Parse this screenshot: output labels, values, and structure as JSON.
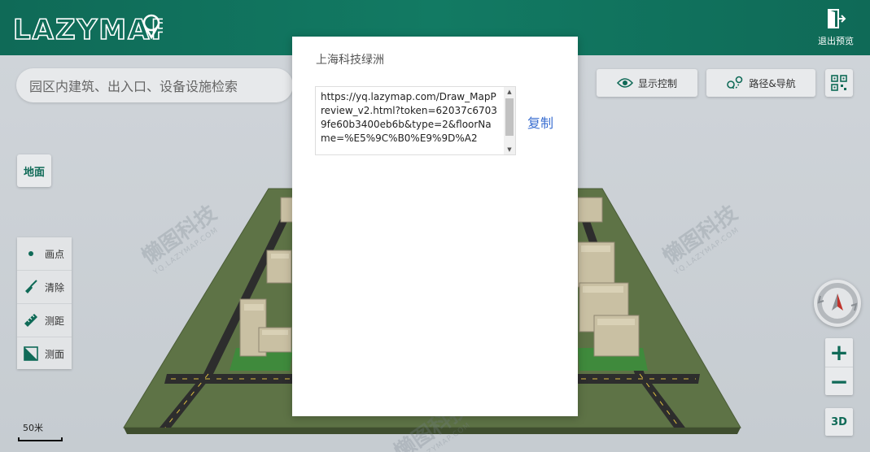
{
  "header": {
    "logo_text": "LAZYMAP",
    "exit_label": "退出预览"
  },
  "search": {
    "placeholder": "园区内建筑、出入口、设备设施检索"
  },
  "toolbar": {
    "display_control": "显示控制",
    "route_nav": "路径&导航"
  },
  "floor": {
    "ground_label": "地面"
  },
  "tools": [
    {
      "label": "画点",
      "icon": "dot-icon"
    },
    {
      "label": "清除",
      "icon": "broom-icon"
    },
    {
      "label": "测距",
      "icon": "ruler-icon"
    },
    {
      "label": "测面",
      "icon": "area-icon"
    }
  ],
  "controls": {
    "zoom_in": "+",
    "zoom_out": "−",
    "mode_3d": "3D"
  },
  "scale": {
    "label": "50米"
  },
  "watermark": {
    "text": "懒图科技",
    "sub": "YQ.LAZYMAP.COM"
  },
  "modal": {
    "title": "上海科技绿洲",
    "url": "https://yq.lazymap.com/Draw_MapPreview_v2.html?token=62037c67039fe60b3400eb6b&type=2&floorName=%E5%9C%B0%E9%9D%A2",
    "copy_label": "复制"
  },
  "colors": {
    "header": "#0f6a57",
    "accent": "#0f6a57",
    "link": "#3b6fd1"
  }
}
